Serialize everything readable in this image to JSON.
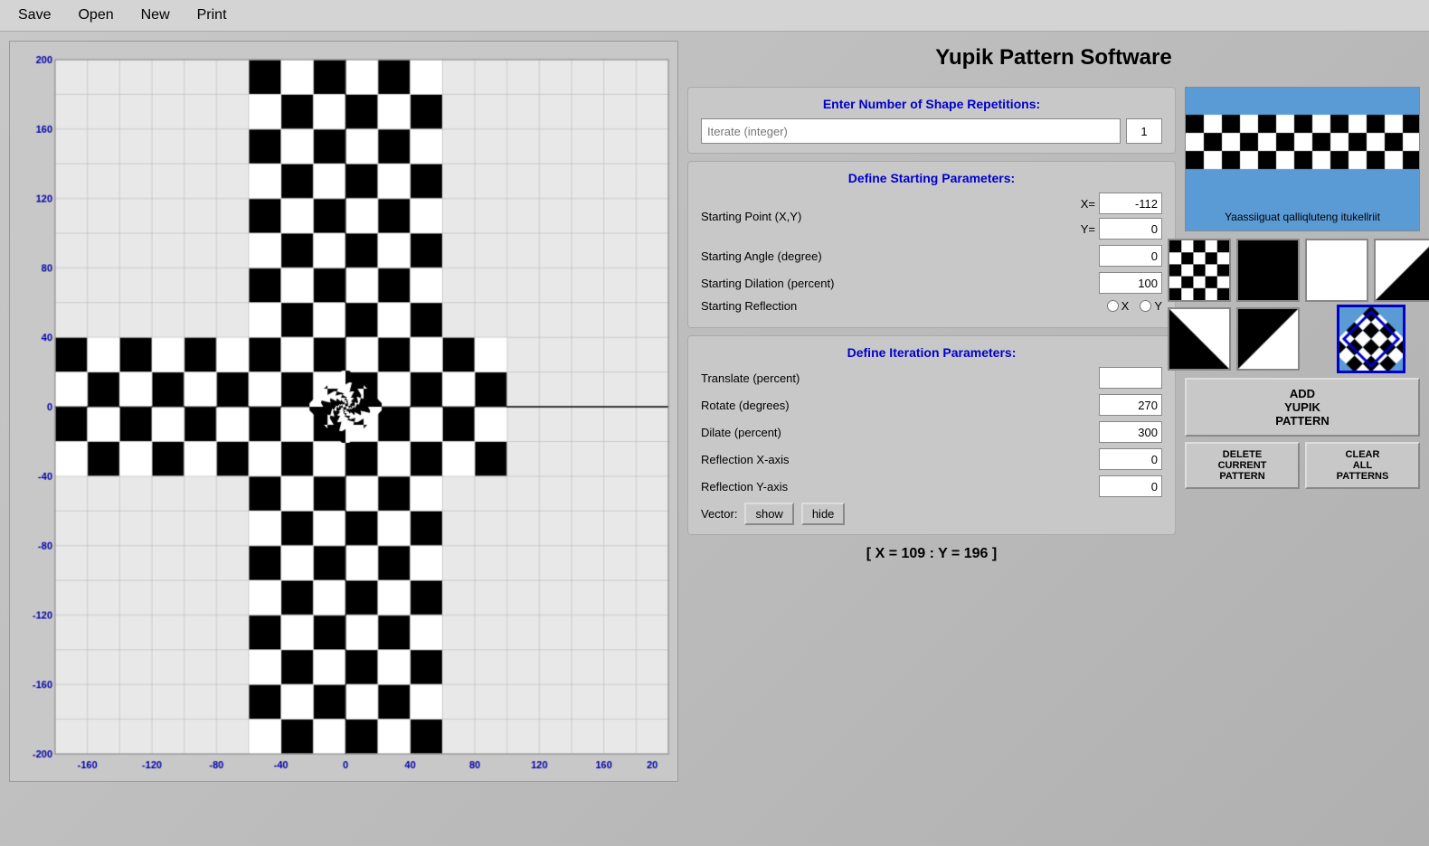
{
  "app": {
    "title": "Yupik Pattern Software"
  },
  "menu": {
    "items": [
      "Save",
      "Open",
      "New",
      "Print"
    ]
  },
  "repetitions": {
    "label": "Enter Number of Shape Repetitions:",
    "input_placeholder": "Iterate (integer)",
    "value": "1"
  },
  "starting_params": {
    "title": "Define Starting Parameters:",
    "starting_point_label": "Starting Point (X,Y)",
    "x_label": "X=",
    "x_value": "-112",
    "y_label": "Y=",
    "y_value": "0",
    "angle_label": "Starting Angle (degree)",
    "angle_value": "0",
    "dilation_label": "Starting Dilation (percent)",
    "dilation_value": "100",
    "reflection_label": "Starting Reflection",
    "reflection_x": "X",
    "reflection_y": "Y"
  },
  "iteration_params": {
    "title": "Define Iteration Parameters:",
    "translate_label": "Translate (percent)",
    "translate_value": "",
    "rotate_label": "Rotate (degrees)",
    "rotate_value": "270",
    "dilate_label": "Dilate (percent)",
    "dilate_value": "300",
    "reflect_x_label": "Reflection X-axis",
    "reflect_x_value": "0",
    "reflect_y_label": "Reflection Y-axis",
    "reflect_y_value": "0",
    "vector_label": "Vector:",
    "show_btn": "show",
    "hide_btn": "hide"
  },
  "preview": {
    "subtitle": "Yaassiiguat qalliqluteng itukellriit"
  },
  "buttons": {
    "add_pattern": "ADD\nYUPIK\nPATTERN",
    "delete_pattern": "DELETE\nCURRENT\nPATTERN",
    "clear_patterns": "CLEAR\nALL\nPATTERNS"
  },
  "coords": {
    "display": "[ X = 109 : Y = 196 ]"
  },
  "axis_labels": {
    "y_positive": [
      "200",
      "160",
      "120",
      "80",
      "40",
      "0",
      "-40",
      "-80",
      "-120",
      "-160",
      "-200"
    ],
    "x_labels": [
      "-160",
      "-120",
      "-80",
      "-40",
      "0",
      "40",
      "80",
      "120",
      "160",
      "20"
    ]
  }
}
